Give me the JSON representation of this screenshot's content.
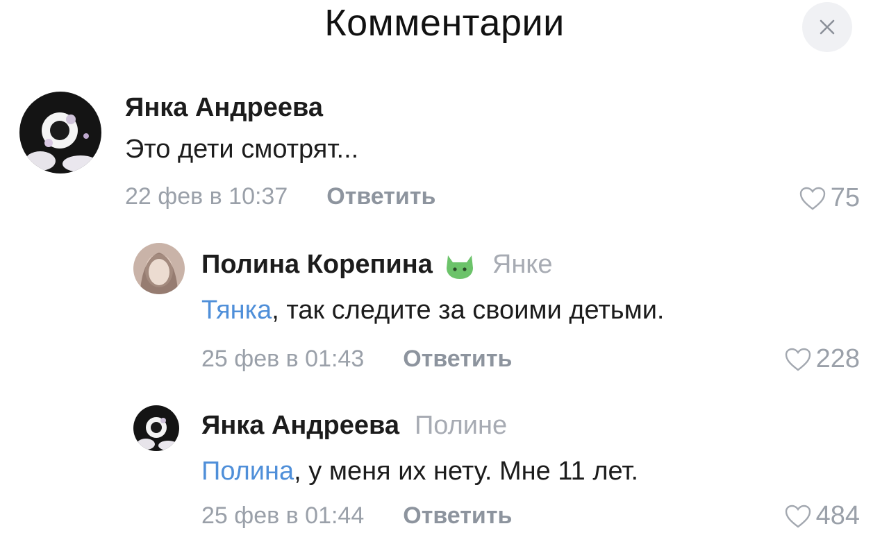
{
  "header": {
    "title": "Комментарии",
    "close_label": "×"
  },
  "comments": [
    {
      "author": "Янка Андреева",
      "reply_to": "",
      "mention": "",
      "text": "Это дети смотрят...",
      "date": "22 фев в 10:37",
      "reply_label": "Ответить",
      "likes": "75"
    },
    {
      "author": "Полина Корепина",
      "reply_to": "Янке",
      "mention": "Тянка",
      "text": ", так следите за своими детьми.",
      "date": "25 фев в 01:43",
      "reply_label": "Ответить",
      "likes": "228"
    },
    {
      "author": "Янка Андреева",
      "reply_to": "Полине",
      "mention": "Полина",
      "text": ", у меня их нету. Мне 11 лет.",
      "date": "25 фев в 01:44",
      "reply_label": "Ответить",
      "likes": "484"
    }
  ],
  "icons": {
    "close": "close-icon",
    "like": "heart-outline-icon",
    "sticker": "green-cat-sticker-icon"
  },
  "colors": {
    "mention": "#4f8fd9",
    "muted": "#9aa0a9",
    "close_bg": "#f0f1f4"
  }
}
